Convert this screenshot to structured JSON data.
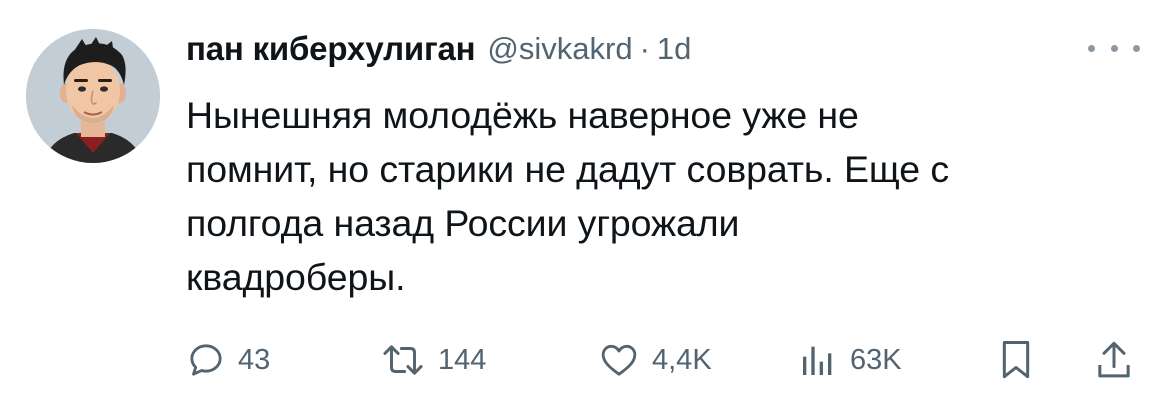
{
  "tweet": {
    "author": {
      "display_name": "пан киберхулиган",
      "handle": "@sivkakrd",
      "separator": "·",
      "time": "1d"
    },
    "text": "Нынешняя молодёжь наверное уже не\nпомнит, но старики не дадут соврать. Еще с\nполгода назад России угрожали\nквадроберы.",
    "actions": {
      "replies": "43",
      "retweets": "144",
      "likes": "4,4K",
      "views": "63K"
    },
    "icons": [
      "more-icon",
      "reply-icon",
      "retweet-icon",
      "like-icon",
      "views-icon",
      "bookmark-icon",
      "share-icon"
    ],
    "colors": {
      "text": "#0f1419",
      "secondary": "#536471"
    }
  }
}
